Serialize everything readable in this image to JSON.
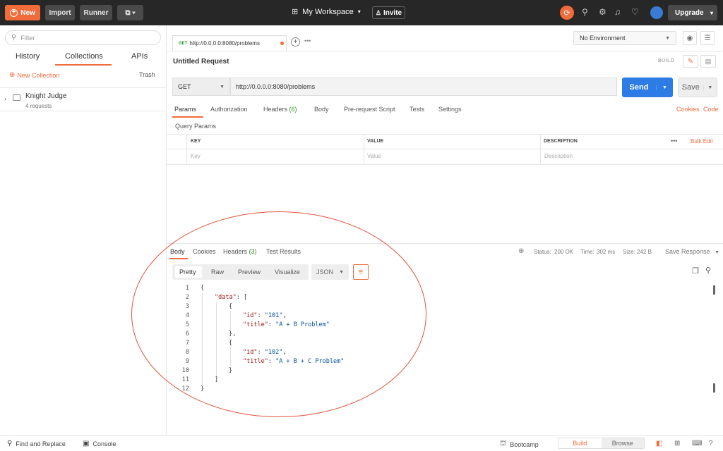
{
  "topbar": {
    "new_label": "New",
    "import_label": "Import",
    "runner_label": "Runner",
    "workspace_label": "My Workspace",
    "invite_label": "Invite",
    "upgrade_label": "Upgrade"
  },
  "sidebar": {
    "filter_placeholder": "Filter",
    "tabs": [
      "History",
      "Collections",
      "APIs"
    ],
    "active_tab": "Collections",
    "new_collection_label": "New Collection",
    "trash_label": "Trash",
    "collections": [
      {
        "name": "Knight Judge",
        "count": "4 requests"
      }
    ]
  },
  "request_tab": {
    "method": "GET",
    "url": "http://0.0.0.0:8080/problems"
  },
  "environment": {
    "selected": "No Environment"
  },
  "request": {
    "title": "Untitled Request",
    "build_label": "BUILD",
    "method": "GET",
    "url": "http://0.0.0.0:8080/problems",
    "send_label": "Send",
    "save_label": "Save",
    "tabs": {
      "params": "Params",
      "authorization": "Authorization",
      "headers": "Headers",
      "headers_count": "(6)",
      "body": "Body",
      "prerequest": "Pre-request Script",
      "tests": "Tests",
      "settings": "Settings"
    },
    "cookies_label": "Cookies",
    "code_label": "Code",
    "query_params_label": "Query Params",
    "table": {
      "key_header": "KEY",
      "value_header": "VALUE",
      "desc_header": "DESCRIPTION",
      "more": "•••",
      "bulk_edit": "Bulk Edit",
      "key_placeholder": "Key",
      "value_placeholder": "Value",
      "desc_placeholder": "Description"
    }
  },
  "response": {
    "tabs": {
      "body": "Body",
      "cookies": "Cookies",
      "headers": "Headers",
      "headers_count": "(3)",
      "test_results": "Test Results"
    },
    "status_label": "Status:",
    "status_value": "200 OK",
    "time_label": "Time:",
    "time_value": "302 ms",
    "size_label": "Size:",
    "size_value": "242 B",
    "save_response_label": "Save Response",
    "formats": [
      "Pretty",
      "Raw",
      "Preview",
      "Visualize"
    ],
    "active_format": "Pretty",
    "language": "JSON",
    "line_numbers": [
      "1",
      "2",
      "3",
      "4",
      "5",
      "6",
      "7",
      "8",
      "9",
      "10",
      "11",
      "12"
    ]
  },
  "bottombar": {
    "find_replace": "Find and Replace",
    "console": "Console",
    "bootcamp": "Bootcamp",
    "build": "Build",
    "browse": "Browse"
  }
}
